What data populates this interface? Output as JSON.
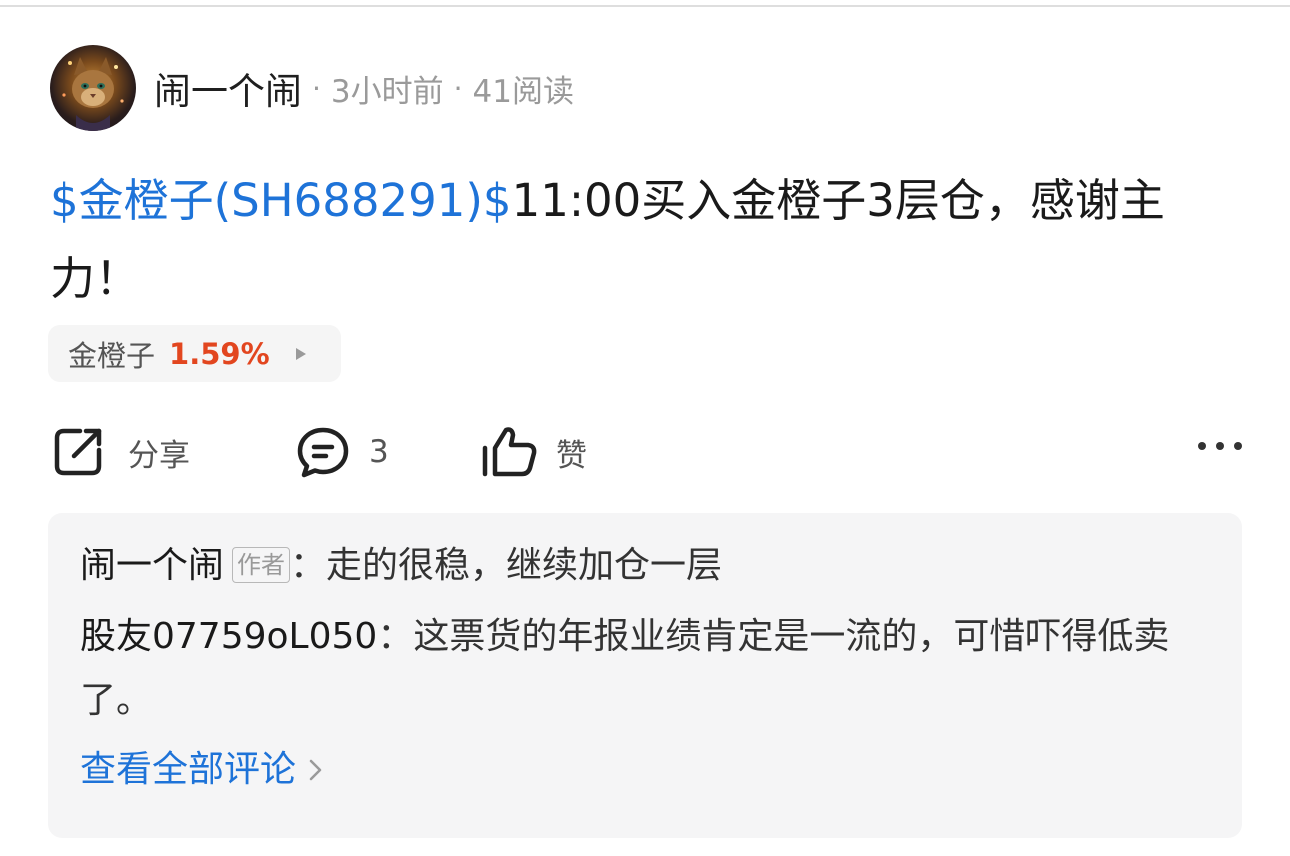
{
  "header": {
    "author": "闹一个闹",
    "separator": "·",
    "time": "3小时前",
    "reads": "41阅读"
  },
  "post": {
    "stock_link": "$金橙子(SH688291)$",
    "text": "11:00买入金橙子3层仓，感谢主力！"
  },
  "stock_chip": {
    "name": "金橙子",
    "change": "1.59%",
    "change_color": "#e2461f"
  },
  "actions": {
    "share_label": "分享",
    "comment_count": "3",
    "like_label": "赞",
    "icons": [
      "share-icon",
      "comment-icon",
      "thumbs-up-icon",
      "more-icon"
    ]
  },
  "comments": [
    {
      "user": "闹一个闹",
      "badge": "作者",
      "colon": "：",
      "text": "走的很稳，继续加仓一层"
    },
    {
      "user": "股友07759oL050",
      "colon": "：",
      "text": "这票货的年报业绩肯定是一流的，可惜吓得低卖了。"
    }
  ],
  "see_all": "查看全部评论",
  "colors": {
    "link": "#1e73d8",
    "up": "#e2461f"
  }
}
